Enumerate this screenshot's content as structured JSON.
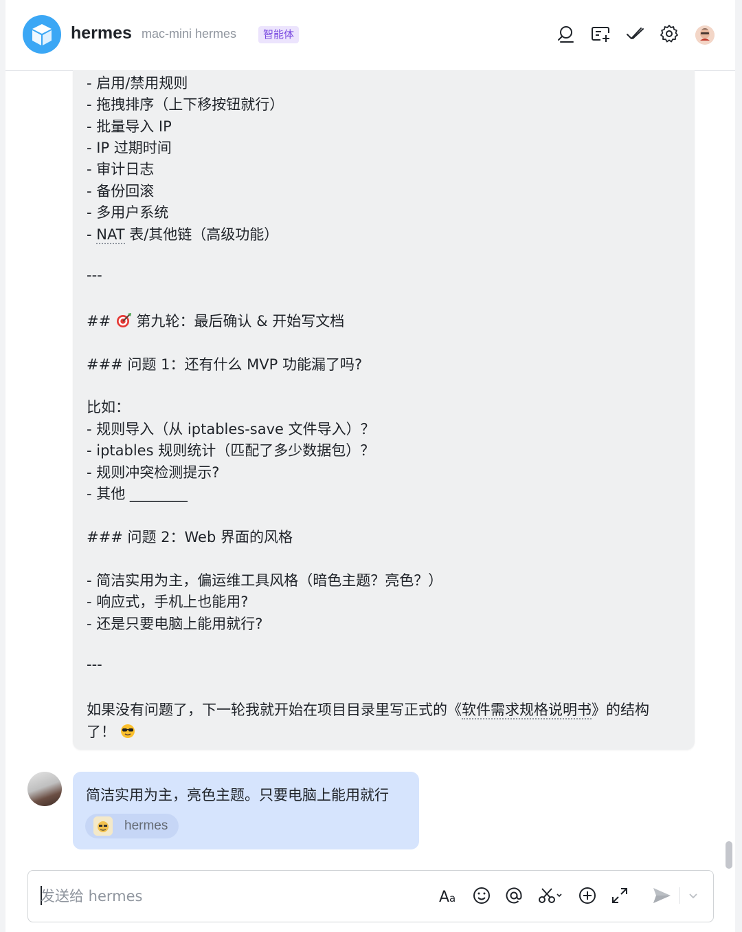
{
  "header": {
    "app_name": "hermes",
    "subtitle": "mac-mini hermes",
    "badge": "智能体",
    "icons": [
      "search-icon",
      "add-chat-icon",
      "checkmark-icon",
      "gear-icon",
      "user-avatar"
    ]
  },
  "bot_message": {
    "lines": [
      "- 启用/禁用规则",
      "- 拖拽排序（上下移按钮就行）",
      "- 批量导入 IP",
      "- IP 过期时间",
      "- 审计日志",
      "- 备份回滚",
      "- 多用户系统",
      "- ",
      "NAT",
      " 表/其他链（高级功能）",
      "---",
      "## ",
      " 第九轮：最后确认 & 开始写文档",
      "### 问题 1：还有什么 MVP 功能漏了吗?",
      "比如：",
      "- 规则导入（从 iptables-save 文件导入）？",
      "- iptables 规则统计（匹配了多少数据包）？",
      "- 规则冲突检测提示?",
      "- 其他 ________",
      "### 问题 2：Web 界面的风格",
      "- 简洁实用为主，偏运维工具风格（暗色主题？亮色？）",
      "- 响应式，手机上也能用?",
      "- 还是只要电脑上能用就行?",
      "---",
      "如果没有问题了，下一轮我就开始在项目目录里写正式的《",
      "软件需求规格说明书",
      "》的结构",
      "了！"
    ],
    "emojis": [
      "target-emoji",
      "sunglasses-emoji"
    ]
  },
  "user_message": {
    "text": "简洁实用为主，亮色主题。只要电脑上能用就行",
    "mention": "hermes"
  },
  "composer": {
    "placeholder": "发送给 hermes",
    "icons": [
      "text-format-icon",
      "emoji-icon",
      "mention-icon",
      "scissors-icon",
      "add-icon",
      "expand-icon",
      "send-icon",
      "chevron-down-icon"
    ]
  },
  "colors": {
    "accent": "#3ba7f5",
    "badge_text": "#7848e0",
    "badge_bg": "#ece4fd",
    "bot_bubble": "#eff0f1",
    "user_bubble": "#d6e4fd"
  }
}
